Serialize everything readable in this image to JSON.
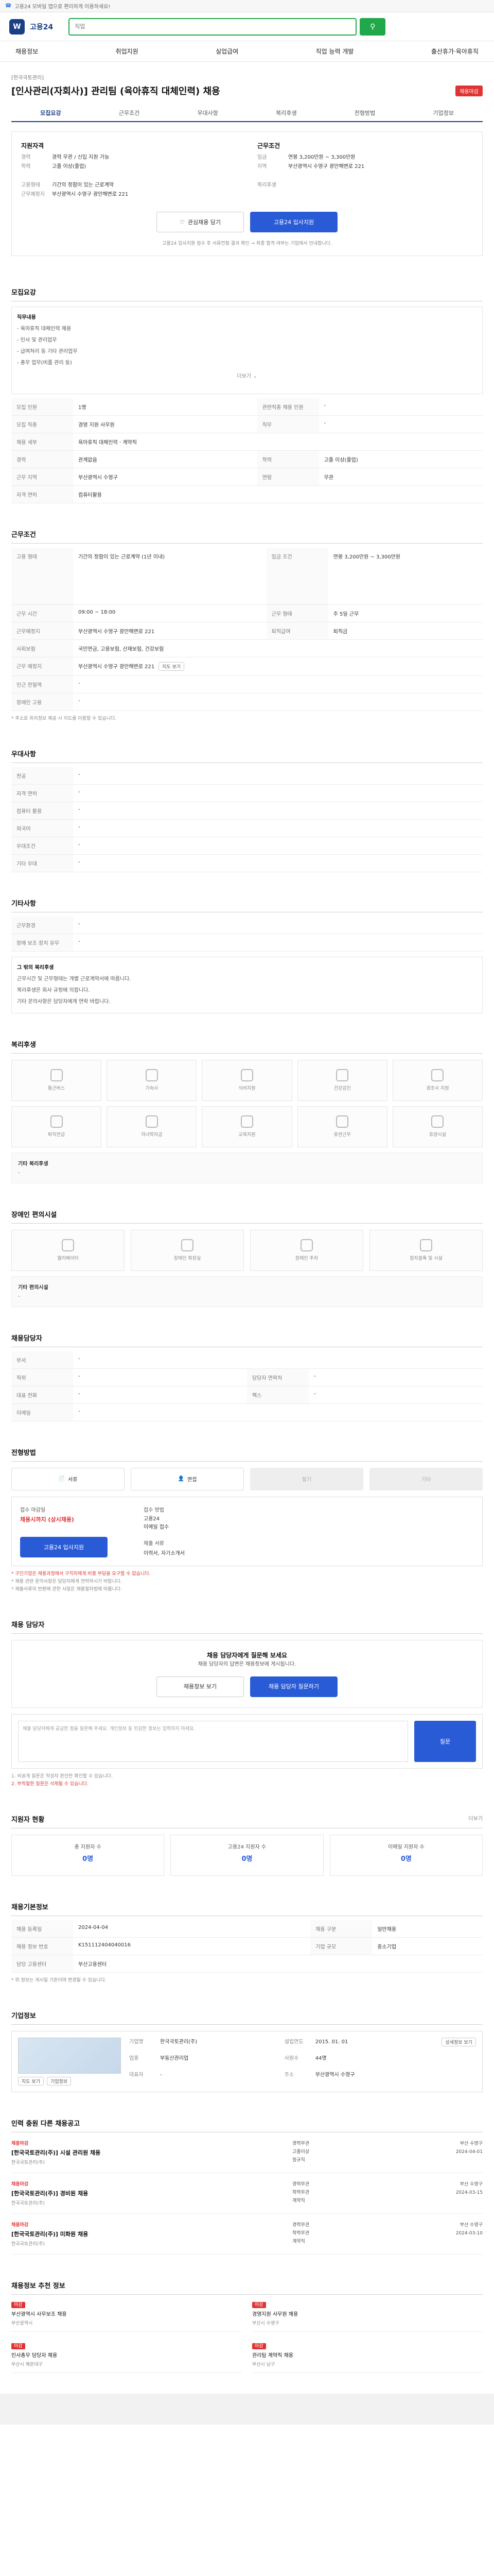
{
  "topbar": {
    "text": "고용24 모바일 앱으로 편리하게 이용하세요!"
  },
  "header": {
    "logo_mark": "W",
    "logo_text": "고용24",
    "search_placeholder": "직업",
    "search_icon": "search-icon"
  },
  "gnb": [
    "채용정보",
    "취업지원",
    "실업급여",
    "직업 능력 개발",
    "출산휴가·육아휴직"
  ],
  "post": {
    "company": "[한국국토관리]",
    "title": "[인사관리(자회사)] 관리팀 (육아휴직 대체인력) 채용",
    "badge": "채용마감",
    "tabs": [
      "모집요강",
      "근무조건",
      "우대사항",
      "복리후생",
      "전형방법",
      "기업정보"
    ],
    "active_tab": "모집요강"
  },
  "summary": {
    "left_title": "지원자격",
    "left": [
      {
        "k": "경력",
        "v": "경력 무관 / 신입 지원 가능"
      },
      {
        "k": "학력",
        "v": "고졸 이상(졸업)"
      },
      {
        "k": "",
        "v": ""
      },
      {
        "k": "고용형태",
        "v": "기간의 정함이 있는 근로계약"
      },
      {
        "k": "근무예정지",
        "v": "부산광역시 수영구 광안해변로 221"
      }
    ],
    "right_title": "근무조건",
    "right": [
      {
        "k": "임금",
        "v": "연봉 3,200만원 ~ 3,300만원"
      },
      {
        "k": "지역",
        "v": "부산광역시 수영구 광안해변로 221"
      },
      {
        "k": "",
        "v": ""
      },
      {
        "k": "복리후생",
        "v": ""
      }
    ],
    "btn_scrap": "관심채용 담기",
    "btn_apply": "고용24 입사지원",
    "notice": "고용24 입사지원 접수 후 서류전형 결과 확인 → 최종 합격 여부는 기업에서 안내합니다."
  },
  "recruit": {
    "title": "모집요강",
    "duties": [
      "직무내용",
      "- 육아휴직 대체인력 채용",
      "- 인사 및 관리업무",
      "- 급여처리 등 기타 관리업무",
      "- 총무 업무(비품 관리 등)"
    ],
    "fold": "더보기",
    "table": [
      {
        "k": "모집 인원",
        "v": "1명",
        "k2": "관련직종 채용 인원",
        "v2": "-"
      },
      {
        "k": "모집 직종",
        "v": "경영 지원 사무원",
        "k2": "직무",
        "v2": "-"
      },
      {
        "k": "채용 세부",
        "v": "육아휴직 대체인력 · 계약직",
        "k2": "",
        "v2": ""
      },
      {
        "k": "경력",
        "v": "관계없음",
        "k2": "학력",
        "v2": "고졸 이상(졸업)"
      },
      {
        "k": "근무 지역",
        "v": "부산광역시 수영구",
        "k2": "연령",
        "v2": "무관"
      },
      {
        "k": "자격 면허",
        "v": "컴퓨터활용",
        "k2": "",
        "v2": ""
      }
    ]
  },
  "work": {
    "title": "근무조건",
    "rows": [
      {
        "k": "고용 형태",
        "v": "기간의 정함이 있는 근로계약 (1년 이내)",
        "k2": "임금 조건",
        "v2": "연봉 3,200만원 ~ 3,300만원"
      },
      {
        "k": "근무 시간",
        "v": "09:00 ~ 18:00",
        "k2": "근무 형태",
        "v2": "주 5일 근무"
      },
      {
        "k": "근무예정지",
        "v": "부산광역시 수영구 광안해변로 221",
        "k2": "퇴직급여",
        "v2": "퇴직금"
      },
      {
        "k": "사회보험",
        "v": "국민연금, 고용보험, 산재보험, 건강보험",
        "k2": "",
        "v2": ""
      },
      {
        "k": "근무 예정지",
        "v": "부산광역시 수영구 광안해변로 221",
        "k2": "",
        "v2": ""
      },
      {
        "k": "인근 전철역",
        "v": "-",
        "k2": "",
        "v2": ""
      },
      {
        "k": "장애인 고용",
        "v": "-",
        "k2": "",
        "v2": ""
      }
    ],
    "note": "* 주소로 위치정보 제공 시 지도를 이용할 수 있습니다.",
    "map_link": "지도 보기"
  },
  "prefer": {
    "title": "우대사항",
    "rows": [
      {
        "k": "전공",
        "v": "-"
      },
      {
        "k": "자격 면허",
        "v": "-"
      },
      {
        "k": "컴퓨터 활용",
        "v": "-"
      },
      {
        "k": "외국어",
        "v": "-"
      },
      {
        "k": "우대조건",
        "v": "-"
      },
      {
        "k": "기타 우대",
        "v": "-"
      }
    ]
  },
  "etc": {
    "title": "기타사항",
    "rows": [
      {
        "k": "근무환경",
        "v": "-"
      },
      {
        "k": "장애 보조 장치 유무",
        "v": "-"
      }
    ],
    "bullets": [
      "그 밖의 복리후생",
      "근무시간 및 근무형태는 개별 근로계약서에 따릅니다.",
      "복리후생은 회사 규정에 의합니다.",
      "기타 문의사항은 담당자에게 연락 바랍니다."
    ]
  },
  "welfare": {
    "title": "복리후생",
    "items": [
      "통근버스",
      "기숙사",
      "식비지원",
      "건강검진",
      "경조사 지원",
      "퇴직연금",
      "자녀학자금",
      "교육지원",
      "유연근무",
      "휴양시설"
    ],
    "other_title": "기타 복리후생",
    "other": "-"
  },
  "welfare2": {
    "title": "장애인 편의시설",
    "items": [
      "엘리베이터",
      "장애인 화장실",
      "장애인 주차",
      "점자블록 및 시설"
    ],
    "other_title": "기타 편의시설",
    "other": "-"
  },
  "contact": {
    "title": "채용담당자",
    "rows": [
      {
        "k": "부서",
        "v": "-",
        "k2": "",
        "v2": ""
      },
      {
        "k": "직위",
        "v": "-",
        "k2": "담당자 연락처",
        "v2": "-"
      },
      {
        "k": "대표 전화",
        "v": "-",
        "k2": "팩스",
        "v2": "-"
      },
      {
        "k": "이메일",
        "v": "-",
        "k2": "",
        "v2": ""
      }
    ]
  },
  "method": {
    "title": "전형방법",
    "items": [
      "서류",
      "면접",
      "필기",
      "기타"
    ],
    "deadline_label": "접수 마감일",
    "deadline": "채용시까지 (상시채용)",
    "method_label": "접수 방법",
    "method_values": [
      "고용24",
      "이메일 접수"
    ],
    "doc_label": "제출 서류",
    "doc_value": "이력서, 자기소개서",
    "apply_btn": "고용24 입사지원",
    "notes": [
      "* 구인기업은 채용과정에서 구직자에게 비용 부담을 요구할 수 없습니다.",
      "* 채용 관련 문의사항은 담당자에게 연락하시기 바랍니다.",
      "* 제출서류의 반환에 관한 사항은 채용절차법에 따릅니다."
    ]
  },
  "qa": {
    "title": "채용 담당자",
    "headline": "채용 담당자에게 질문해 보세요",
    "desc": "채용 담당자의 답변은 채용정보에 게시됩니다.",
    "btn1": "채용정보 보기",
    "btn2": "채용 담당자 질문하기",
    "form_placeholder": "채용 담당자에게 궁금한 점을 질문해 주세요. 개인정보 등 민감한 정보는 입력하지 마세요.",
    "send": "질문",
    "notes": [
      "1. 비공개 질문은 작성자 본인만 확인할 수 있습니다.",
      "2. 부적절한 질문은 삭제될 수 있습니다."
    ]
  },
  "status": {
    "title": "지원자 현황",
    "more": "더보기",
    "items": [
      {
        "label": "총 지원자 수",
        "value": "0명"
      },
      {
        "label": "고용24 지원자 수",
        "value": "0명"
      },
      {
        "label": "이메일 지원자 수",
        "value": "0명"
      }
    ]
  },
  "info": {
    "title": "채용기본정보",
    "rows": [
      {
        "k": "채용 등록일",
        "v": "2024-04-04",
        "k2": "채용 구분",
        "v2": "일반채용"
      },
      {
        "k": "채용 정보 번호",
        "v": "K151112404040016",
        "k2": "기업 규모",
        "v2": "중소기업"
      },
      {
        "k": "담당 고용센터",
        "v": "부산고용센터",
        "k2": "",
        "v2": ""
      }
    ],
    "note": "* 위 정보는 게시일 기준이며 변경될 수 있습니다."
  },
  "company": {
    "title": "기업정보",
    "name": "한국국토관리(주)",
    "btn1": "지도 보기",
    "btn2": "기업정보",
    "rows": [
      {
        "k": "기업명",
        "v": "한국국토관리(주)"
      },
      {
        "k": "업종",
        "v": "부동산관리업"
      },
      {
        "k": "대표자",
        "v": "-"
      },
      {
        "k": "설립연도",
        "v": "2015. 01. 01"
      },
      {
        "k": "사원수",
        "v": "44명"
      },
      {
        "k": "주소",
        "v": "부산광역시 수영구"
      }
    ],
    "detail_btn": "상세정보 보기"
  },
  "same_company": {
    "title": "인력 충원 다른 채용공고",
    "jobs": [
      {
        "tag": "채용마감",
        "title": "[한국국토관리(주)] 시설 관리원 채용",
        "sub": "한국국토관리(주)",
        "mid": [
          "경력무관",
          "고졸이상",
          "정규직"
        ],
        "right": [
          "부산 수영구",
          "2024-04-01"
        ]
      },
      {
        "tag": "채용마감",
        "title": "[한국국토관리(주)] 경비원 채용",
        "sub": "한국국토관리(주)",
        "mid": [
          "경력무관",
          "학력무관",
          "계약직"
        ],
        "right": [
          "부산 수영구",
          "2024-03-15"
        ]
      },
      {
        "tag": "채용마감",
        "title": "[한국국토관리(주)] 미화원 채용",
        "sub": "한국국토관리(주)",
        "mid": [
          "경력무관",
          "학력무관",
          "계약직"
        ],
        "right": [
          "부산 수영구",
          "2024-03-10"
        ]
      }
    ]
  },
  "recommend": {
    "title": "채용정보 추천 정보",
    "items": [
      {
        "badge": "마감",
        "title": "부산광역시 사무보조 채용",
        "sub": "부산광역시"
      },
      {
        "badge": "마감",
        "title": "경영지원 사무원 채용",
        "sub": "부산시 수영구"
      },
      {
        "badge": "마감",
        "title": "인사총무 담당자 채용",
        "sub": "부산시 해운대구"
      },
      {
        "badge": "마감",
        "title": "관리팀 계약직 채용",
        "sub": "부산시 남구"
      }
    ]
  }
}
